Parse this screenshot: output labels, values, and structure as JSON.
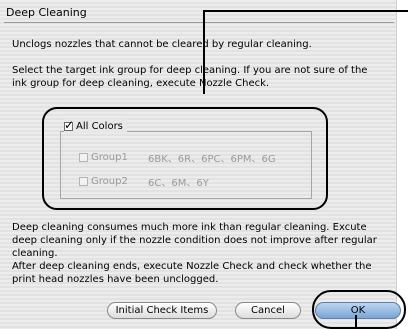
{
  "window": {
    "title": "Deep Cleaning"
  },
  "text": {
    "intro": "Unclogs nozzles that cannot be cleared by regular cleaning.",
    "select_line1": "Select the target ink group for deep cleaning. If you are not sure of the",
    "select_line2": "ink group for deep cleaning, execute Nozzle Check.",
    "warn_line1": "Deep cleaning consumes much more ink than regular cleaning. Excute",
    "warn_line2": "deep cleaning only if the nozzle condition does not improve after regular",
    "warn_line3": "cleaning.",
    "after_line1": "After deep cleaning ends, execute Nozzle Check and check whether the",
    "after_line2": "print head nozzles have been unclogged."
  },
  "ink_group": {
    "all_colors": {
      "label": "All Colors",
      "checked": true
    },
    "groups": [
      {
        "label": "Group1",
        "inks": "6BK、6R、6PC、6PM、6G",
        "checked": false,
        "enabled": false
      },
      {
        "label": "Group2",
        "inks": "6C、6M、6Y",
        "checked": false,
        "enabled": false
      }
    ]
  },
  "buttons": {
    "initial_check": "Initial Check Items",
    "cancel": "Cancel",
    "ok": "OK"
  }
}
